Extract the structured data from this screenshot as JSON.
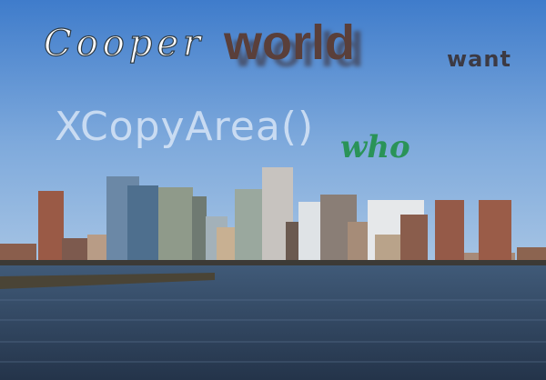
{
  "overlay_words": {
    "w1": "Cooper",
    "w2": "world",
    "w3": "want",
    "w4": "XCopyArea()",
    "w5": "who"
  },
  "colors": {
    "sky_top": "#3f7ccb",
    "sky_bottom": "#a6c4e4",
    "water": "#2e3f55",
    "word_green": "#2a9358",
    "word_brown": "#5a3f3a"
  }
}
